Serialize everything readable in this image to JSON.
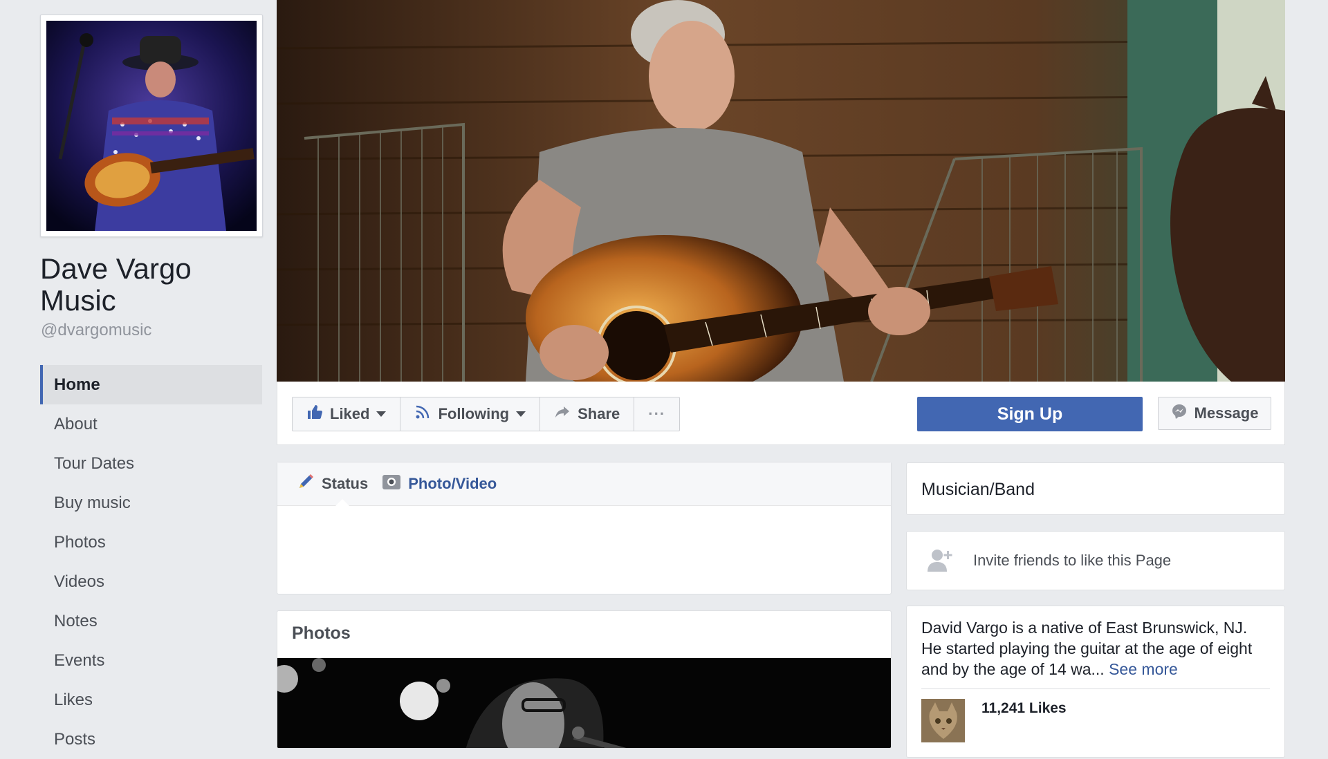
{
  "page": {
    "name": "Dave Vargo Music",
    "handle": "@dvargomusic"
  },
  "sidebar": {
    "items": [
      {
        "label": "Home",
        "active": true
      },
      {
        "label": "About"
      },
      {
        "label": "Tour Dates"
      },
      {
        "label": "Buy music"
      },
      {
        "label": "Photos"
      },
      {
        "label": "Videos"
      },
      {
        "label": "Notes"
      },
      {
        "label": "Events"
      },
      {
        "label": "Likes"
      },
      {
        "label": "Posts"
      }
    ]
  },
  "actions": {
    "liked": "Liked",
    "following": "Following",
    "share": "Share",
    "more": "···",
    "signup": "Sign Up",
    "message": "Message"
  },
  "composer": {
    "status": "Status",
    "photo_video": "Photo/Video"
  },
  "photos": {
    "title": "Photos"
  },
  "right": {
    "category": "Musician/Band",
    "invite": "Invite friends to like this Page",
    "about": "David Vargo is a native of East Brunswick, NJ. He started playing the guitar at the age of eight and by the age of 14 wa...",
    "see_more": "See more",
    "likes": "11,241 Likes"
  },
  "colors": {
    "brand": "#4267b2",
    "link": "#365899",
    "background": "#e9ebee"
  },
  "icons": [
    "thumbs-up-icon",
    "rss-icon",
    "share-arrow-icon",
    "more-dots-icon",
    "messenger-icon",
    "pencil-icon",
    "camera-icon",
    "add-friend-icon"
  ]
}
